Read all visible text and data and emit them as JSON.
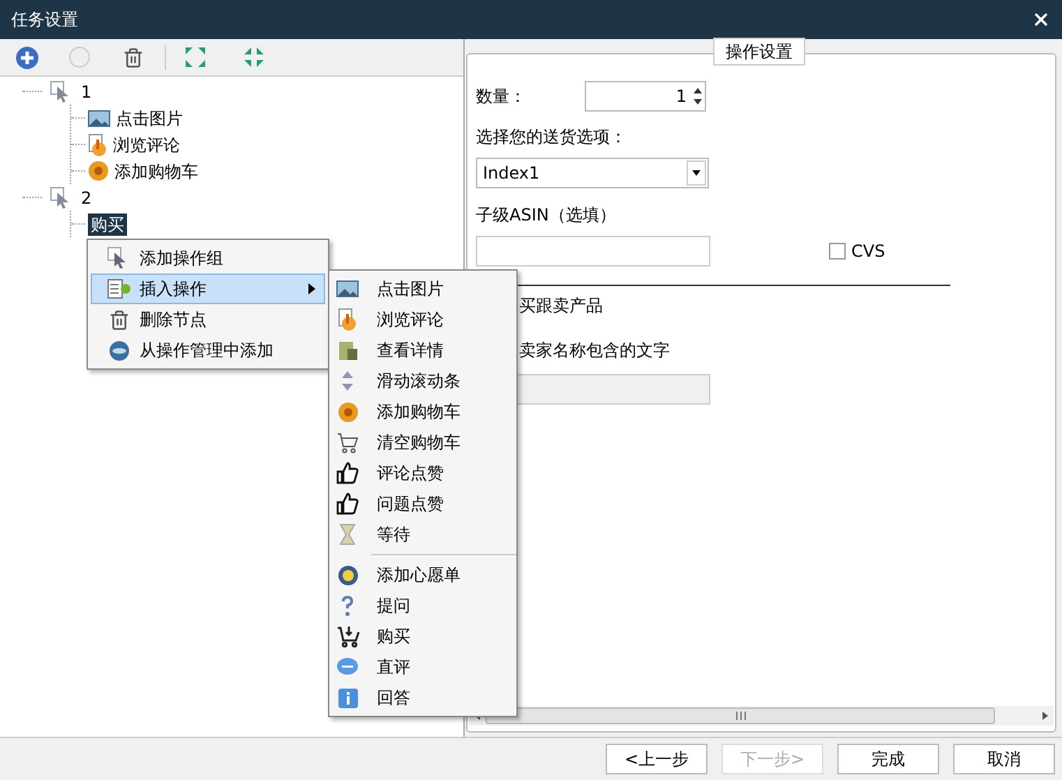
{
  "window": {
    "title": "任务设置"
  },
  "tree": [
    {
      "label": "1",
      "children": [
        {
          "label": "点击图片",
          "kind": "image",
          "selected": false
        },
        {
          "label": "浏览评论",
          "kind": "browse",
          "selected": false
        },
        {
          "label": "添加购物车",
          "kind": "cart",
          "selected": false
        }
      ]
    },
    {
      "label": "2",
      "children": [
        {
          "label": "购买",
          "selected": true
        }
      ]
    }
  ],
  "context_menu": [
    {
      "label": "添加操作组",
      "kind": "group",
      "selected": false,
      "submenu": false
    },
    {
      "label": "插入操作",
      "kind": "insert",
      "selected": true,
      "submenu": true
    },
    {
      "label": "删除节点",
      "kind": "delete",
      "selected": false,
      "submenu": false
    },
    {
      "label": "从操作管理中添加",
      "kind": "manage",
      "selected": false,
      "submenu": false
    }
  ],
  "submenu_groups": [
    [
      {
        "label": "点击图片",
        "kind": "image"
      },
      {
        "label": "浏览评论",
        "kind": "browse"
      },
      {
        "label": "查看详情",
        "kind": "details"
      },
      {
        "label": "滑动滚动条",
        "kind": "scroll"
      },
      {
        "label": "添加购物车",
        "kind": "cart"
      },
      {
        "label": "清空购物车",
        "kind": "empty_cart"
      },
      {
        "label": "评论点赞",
        "kind": "like"
      },
      {
        "label": "问题点赞",
        "kind": "like"
      },
      {
        "label": "等待",
        "kind": "wait"
      }
    ],
    [
      {
        "label": "添加心愿单",
        "kind": "wishlist"
      },
      {
        "label": "提问",
        "kind": "question"
      },
      {
        "label": "购买",
        "kind": "buy"
      },
      {
        "label": "直评",
        "kind": "review"
      },
      {
        "label": "回答",
        "kind": "answer"
      }
    ]
  ],
  "settings": {
    "title": "操作设置",
    "quantity_label": "数量：",
    "quantity": "1",
    "shipping_label": "选择您的送货选项：",
    "shipping_value": "Index1",
    "asin_label": "子级ASIN（选填）",
    "cvs": {
      "label": "CVS",
      "checked": false
    },
    "buy_follow_label": "买跟卖产品",
    "seller_text_label": "卖家名称包含的文字"
  },
  "buttons": [
    {
      "label": "<上一步",
      "disabled": false
    },
    {
      "label": "下一步>",
      "disabled": true
    },
    {
      "label": "完成",
      "disabled": false
    },
    {
      "label": "取消",
      "disabled": false
    }
  ]
}
